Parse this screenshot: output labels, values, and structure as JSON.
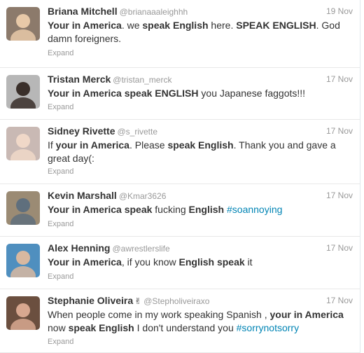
{
  "tweets": [
    {
      "name": "Briana Mitchell",
      "handle": "@brianaaaleighhh",
      "time": "19 Nov",
      "segments": [
        {
          "t": "Your in America",
          "s": "b"
        },
        {
          "t": ". we ",
          "s": ""
        },
        {
          "t": "speak English",
          "s": "b"
        },
        {
          "t": " here. ",
          "s": ""
        },
        {
          "t": "SPEAK ENGLISH",
          "s": "b"
        },
        {
          "t": ". God damn foreigners.",
          "s": ""
        }
      ],
      "expand": "Expand"
    },
    {
      "name": "Tristan Merck",
      "handle": "@tristan_merck",
      "time": "17 Nov",
      "segments": [
        {
          "t": "Your in America speak ENGLISH",
          "s": "b"
        },
        {
          "t": " you Japanese faggots!!!",
          "s": ""
        }
      ],
      "expand": "Expand"
    },
    {
      "name": "Sidney Rivette",
      "handle": "@s_rivette",
      "time": "17 Nov",
      "segments": [
        {
          "t": "If ",
          "s": ""
        },
        {
          "t": "your in America",
          "s": "b"
        },
        {
          "t": ". Please ",
          "s": ""
        },
        {
          "t": "speak English",
          "s": "b"
        },
        {
          "t": ". Thank you and gave a great day(:",
          "s": ""
        }
      ],
      "expand": "Expand"
    },
    {
      "name": "Kevin Marshall",
      "handle": "@Kmar3626",
      "time": "17 Nov",
      "segments": [
        {
          "t": "Your in America speak",
          "s": "b"
        },
        {
          "t": " fucking ",
          "s": ""
        },
        {
          "t": "English",
          "s": "b"
        },
        {
          "t": " ",
          "s": ""
        },
        {
          "t": "#soannoying",
          "s": "tag"
        }
      ],
      "expand": "Expand"
    },
    {
      "name": "Alex Henning",
      "handle": "@awrestlerslife",
      "time": "17 Nov",
      "segments": [
        {
          "t": "Your in America",
          "s": "b"
        },
        {
          "t": ", if you know ",
          "s": ""
        },
        {
          "t": "English speak",
          "s": "b"
        },
        {
          "t": " it",
          "s": ""
        }
      ],
      "expand": "Expand"
    },
    {
      "name": "Stephanie Oliveira",
      "badge": "✌",
      "handle": "@Stepholiveiraxo",
      "time": "17 Nov",
      "segments": [
        {
          "t": "When people come in my work speaking Spanish , ",
          "s": ""
        },
        {
          "t": "your in America",
          "s": "b"
        },
        {
          "t": " now ",
          "s": ""
        },
        {
          "t": "speak English",
          "s": "b"
        },
        {
          "t": " I don't understand you ",
          "s": ""
        },
        {
          "t": "#sorrynotsorry",
          "s": "tag"
        }
      ],
      "expand": "Expand"
    }
  ],
  "avatars": [
    {
      "icon": "profile-photo-icon",
      "bg": "#8c7a6b",
      "fg": "#e8c9a8"
    },
    {
      "icon": "profile-photo-icon",
      "bg": "#b7b7b7",
      "fg": "#3a2f2a"
    },
    {
      "icon": "profile-photo-icon",
      "bg": "#c9b9b4",
      "fg": "#f0d8c8"
    },
    {
      "icon": "profile-photo-icon",
      "bg": "#9b8b74",
      "fg": "#5f6f7d"
    },
    {
      "icon": "profile-photo-icon",
      "bg": "#4f8fbf",
      "fg": "#d8b8a0"
    },
    {
      "icon": "profile-photo-icon",
      "bg": "#6b4f3f",
      "fg": "#d8a890"
    }
  ],
  "colors": {
    "name": "#333333",
    "meta": "#999999",
    "hashtag": "#0084b4",
    "divider": "#e8e8e8"
  }
}
